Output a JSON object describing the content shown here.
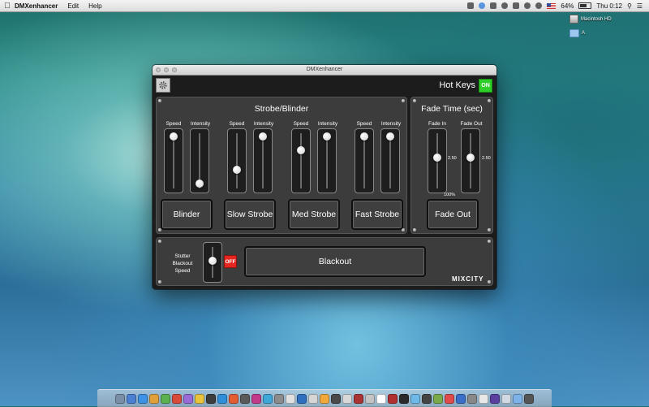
{
  "menubar": {
    "apple_symbol": "",
    "app_name": "DMXenhancer",
    "items": [
      "Edit",
      "Help"
    ],
    "battery": "64%",
    "clock": "Thu 0:12"
  },
  "desktop": {
    "icons": [
      {
        "label": "Macintosh HD",
        "icon": "hard-drive-icon"
      },
      {
        "label": "A",
        "icon": "folder-icon"
      }
    ]
  },
  "window": {
    "title": "DMXenhancer",
    "hot_keys": {
      "label": "Hot Keys",
      "state": "ON",
      "color": "#2fcf2a"
    },
    "strobe_panel": {
      "title": "Strobe/Blinder",
      "groups": [
        {
          "button": "Blinder",
          "speed_label": "Speed",
          "intensity_label": "Intensity",
          "speed": 1.0,
          "intensity": 0.0
        },
        {
          "button": "Slow Strobe",
          "speed_label": "Speed",
          "intensity_label": "Intensity",
          "speed": 0.3,
          "intensity": 1.0
        },
        {
          "button": "Med Strobe",
          "speed_label": "Speed",
          "intensity_label": "Intensity",
          "speed": 0.7,
          "intensity": 1.0
        },
        {
          "button": "Fast Strobe",
          "speed_label": "Speed",
          "intensity_label": "Intensity",
          "speed": 1.0,
          "intensity": 1.0
        }
      ]
    },
    "fade_panel": {
      "title": "Fade Time (sec)",
      "fade_in_label": "Fade In",
      "fade_out_label": "Fade Out",
      "fade_in_value": "2.50",
      "fade_out_value": "2.50",
      "fade_in_level": 0.55,
      "fade_out_level": 0.55,
      "percent": "100%",
      "button": "Fade Out"
    },
    "bottom_panel": {
      "stutter_label": "Stutter Blackout Speed",
      "stutter_level": 0.55,
      "toggle": {
        "state": "OFF",
        "color": "#e52620"
      },
      "blackout_button": "Blackout",
      "brand": "MIXCITY"
    }
  },
  "dock": {
    "app_colors": [
      "#7a8ea8",
      "#4b7fd1",
      "#3d91e6",
      "#e0a13a",
      "#5bb14f",
      "#d84a3a",
      "#9a6ad6",
      "#e8c33b",
      "#3d3d3d",
      "#2f8ed9",
      "#e25d33",
      "#5a5a5a",
      "#c23a8a",
      "#3fa6d8",
      "#8c8c8c",
      "#e0e0e0",
      "#2e6fbf",
      "#d6d6d6",
      "#f2a93b",
      "#4a4a4a",
      "#d8d8d8",
      "#a33",
      "#c4c4c4",
      "#ffffff",
      "#b03030",
      "#2a2a2a",
      "#6fb9e8",
      "#444",
      "#79a94a",
      "#e04a4a",
      "#3b6ec9",
      "#888",
      "#e8e8e8",
      "#5a3fa0",
      "#cfd8e3",
      "#7db3e8",
      "#555"
    ]
  }
}
